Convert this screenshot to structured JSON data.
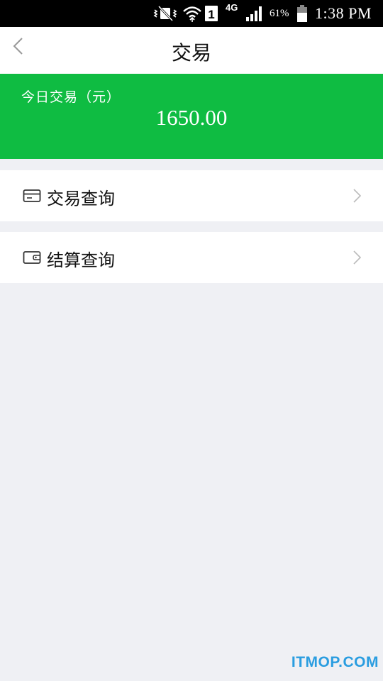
{
  "status_bar": {
    "network": "4G",
    "sim_slot": "1",
    "battery_percent": "61%",
    "time": "1:38 PM"
  },
  "header": {
    "title": "交易",
    "back_icon": "chevron-left-icon"
  },
  "summary": {
    "label": "今日交易（元）",
    "amount": "1650.00",
    "background_color": "#0fbc42"
  },
  "menu": {
    "items": [
      {
        "label": "交易查询",
        "icon": "card-icon"
      },
      {
        "label": "结算查询",
        "icon": "wallet-icon"
      }
    ]
  },
  "watermark": "ITMOP.COM",
  "colors": {
    "accent_green": "#0fbc42",
    "page_background": "#eff0f4",
    "watermark_blue": "#2a9de0"
  }
}
